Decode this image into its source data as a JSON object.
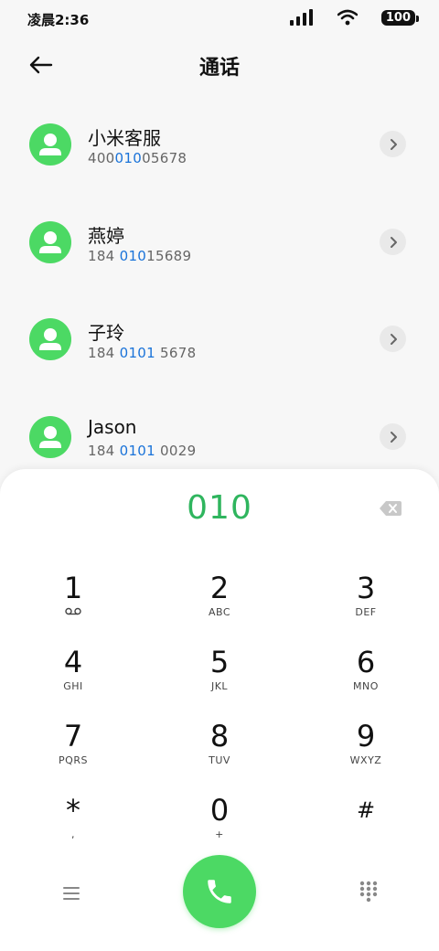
{
  "status_bar": {
    "time": "凌晨2:36",
    "battery": "100"
  },
  "header": {
    "title": "通话"
  },
  "contacts": [
    {
      "name": "小米客服",
      "number_pre": "400",
      "number_match": "010",
      "number_post": "05678"
    },
    {
      "name": "燕婷",
      "number_pre": "184 ",
      "number_match": "010",
      "number_post": "15689"
    },
    {
      "name": "子玲",
      "number_pre": "184 ",
      "number_match": "0101",
      "number_post": " 5678"
    },
    {
      "name": "Jason",
      "number_pre": "184 ",
      "number_match": "0101",
      "number_post": " 0029"
    }
  ],
  "dialer": {
    "dialed_number": "010",
    "keys": [
      {
        "digit": "1",
        "letters": ""
      },
      {
        "digit": "2",
        "letters": "ABC"
      },
      {
        "digit": "3",
        "letters": "DEF"
      },
      {
        "digit": "4",
        "letters": "GHI"
      },
      {
        "digit": "5",
        "letters": "JKL"
      },
      {
        "digit": "6",
        "letters": "MNO"
      },
      {
        "digit": "7",
        "letters": "PQRS"
      },
      {
        "digit": "8",
        "letters": "TUV"
      },
      {
        "digit": "9",
        "letters": "WXYZ"
      },
      {
        "digit": "*",
        "letters": ","
      },
      {
        "digit": "0",
        "letters": "+"
      },
      {
        "digit": "#",
        "letters": ""
      }
    ]
  },
  "colors": {
    "accent_green": "#4cd964",
    "dialed_text": "#2fb55e",
    "match_blue": "#1a73d9"
  }
}
